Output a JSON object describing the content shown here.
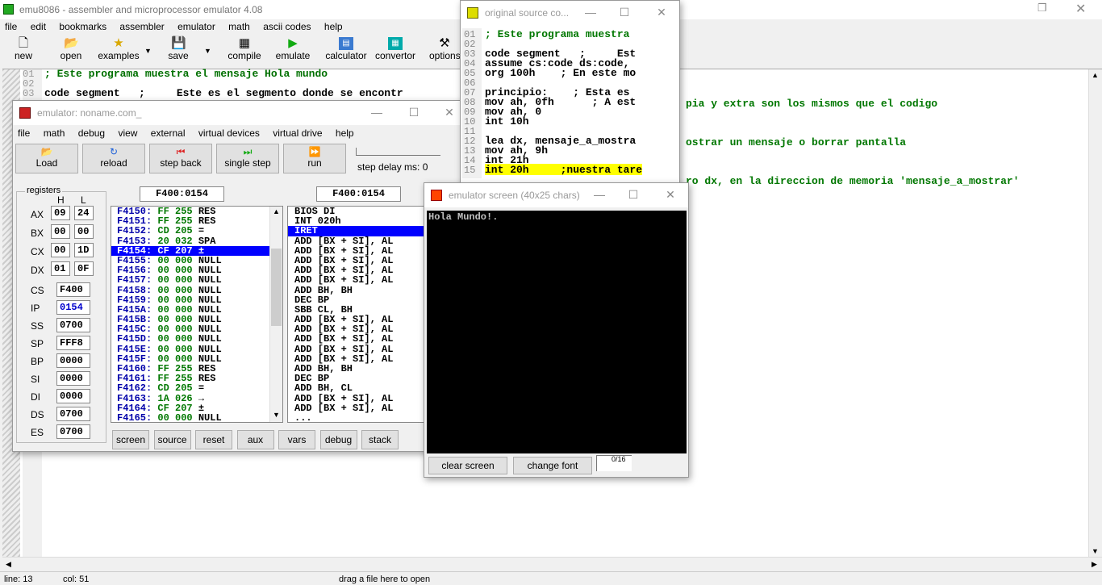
{
  "main_window": {
    "title": "emu8086 - assembler and microprocessor emulator 4.08",
    "menu": [
      "file",
      "edit",
      "bookmarks",
      "assembler",
      "emulator",
      "math",
      "ascii codes",
      "help"
    ],
    "toolbar": [
      {
        "label": "new",
        "icon": "new-file-icon"
      },
      {
        "label": "open",
        "icon": "open-folder-icon"
      },
      {
        "label": "examples",
        "icon": "star-icon"
      },
      {
        "label": "save",
        "icon": "floppy-disk-icon"
      },
      {
        "label": "compile",
        "icon": "compile-icon"
      },
      {
        "label": "emulate",
        "icon": "play-icon"
      },
      {
        "label": "calculator",
        "icon": "calculator-icon"
      },
      {
        "label": "convertor",
        "icon": "convertor-icon"
      },
      {
        "label": "options",
        "icon": "tools-icon"
      }
    ],
    "editor_lines": [
      {
        "num": "01",
        "text": "; Este programa muestra el mensaje Hola mundo"
      },
      {
        "num": "02",
        "text": ""
      },
      {
        "num": "03",
        "text": "code segment   ;     Este es el segmento donde se encontr"
      }
    ],
    "editor_right_fragments": [
      "pia y extra son los mismos que el codigo",
      "ostrar un mensaje o borrar pantalla",
      "ro dx, en la direccion de memoria 'mensaje_a_mostrar'"
    ],
    "status": {
      "line": "line: 13",
      "col": "col: 51",
      "drag_hint": "drag a file here to open"
    }
  },
  "emulator_window": {
    "title": "emulator: noname.com_",
    "menu": [
      "file",
      "math",
      "debug",
      "view",
      "external",
      "virtual devices",
      "virtual drive",
      "help"
    ],
    "buttons": {
      "load": "Load",
      "reload": "reload",
      "step_back": "step back",
      "single_step": "single step",
      "run": "run"
    },
    "step_delay": "step delay ms: 0",
    "registers_label": "registers",
    "h_label": "H",
    "l_label": "L",
    "registers_hl": [
      {
        "name": "AX",
        "h": "09",
        "l": "24"
      },
      {
        "name": "BX",
        "h": "00",
        "l": "00"
      },
      {
        "name": "CX",
        "h": "00",
        "l": "1D"
      },
      {
        "name": "DX",
        "h": "01",
        "l": "0F"
      }
    ],
    "registers_full": [
      {
        "name": "CS",
        "value": "F400"
      },
      {
        "name": "IP",
        "value": "0154"
      },
      {
        "name": "SS",
        "value": "0700"
      },
      {
        "name": "SP",
        "value": "FFF8"
      },
      {
        "name": "BP",
        "value": "0000"
      },
      {
        "name": "SI",
        "value": "0000"
      },
      {
        "name": "DI",
        "value": "0000"
      },
      {
        "name": "DS",
        "value": "0700"
      },
      {
        "name": "ES",
        "value": "0700"
      }
    ],
    "addr_left": "F400:0154",
    "addr_right": "F400:0154",
    "memory": [
      [
        "F4150:",
        "FF",
        "255",
        "RES"
      ],
      [
        "F4151:",
        "FF",
        "255",
        "RES"
      ],
      [
        "F4152:",
        "CD",
        "205",
        "="
      ],
      [
        "F4153:",
        "20",
        "032",
        "SPA"
      ],
      [
        "F4154:",
        "CF",
        "207",
        "±"
      ],
      [
        "F4155:",
        "00",
        "000",
        "NULL"
      ],
      [
        "F4156:",
        "00",
        "000",
        "NULL"
      ],
      [
        "F4157:",
        "00",
        "000",
        "NULL"
      ],
      [
        "F4158:",
        "00",
        "000",
        "NULL"
      ],
      [
        "F4159:",
        "00",
        "000",
        "NULL"
      ],
      [
        "F415A:",
        "00",
        "000",
        "NULL"
      ],
      [
        "F415B:",
        "00",
        "000",
        "NULL"
      ],
      [
        "F415C:",
        "00",
        "000",
        "NULL"
      ],
      [
        "F415D:",
        "00",
        "000",
        "NULL"
      ],
      [
        "F415E:",
        "00",
        "000",
        "NULL"
      ],
      [
        "F415F:",
        "00",
        "000",
        "NULL"
      ],
      [
        "F4160:",
        "FF",
        "255",
        "RES"
      ],
      [
        "F4161:",
        "FF",
        "255",
        "RES"
      ],
      [
        "F4162:",
        "CD",
        "205",
        "="
      ],
      [
        "F4163:",
        "1A",
        "026",
        "→"
      ],
      [
        "F4164:",
        "CF",
        "207",
        "±"
      ],
      [
        "F4165:",
        "00",
        "000",
        "NULL"
      ]
    ],
    "memory_selected_index": 4,
    "disasm": [
      "BIOS DI",
      "INT 020h",
      "IRET",
      "ADD [BX + SI], AL",
      "ADD [BX + SI], AL",
      "ADD [BX + SI], AL",
      "ADD [BX + SI], AL",
      "ADD [BX + SI], AL",
      "ADD BH, BH",
      "DEC BP",
      "SBB CL, BH",
      "ADD [BX + SI], AL",
      "ADD [BX + SI], AL",
      "ADD [BX + SI], AL",
      "ADD [BX + SI], AL",
      "ADD [BX + SI], AL",
      "ADD BH, BH",
      "DEC BP",
      "ADD BH, CL",
      "ADD [BX + SI], AL",
      "ADD [BX + SI], AL",
      "..."
    ],
    "disasm_selected_index": 2,
    "bottom_buttons": [
      "screen",
      "source",
      "reset",
      "aux",
      "vars",
      "debug",
      "stack"
    ]
  },
  "source_window": {
    "title": "original source co...",
    "lines": [
      {
        "num": "01",
        "text": "; Este programa muestra"
      },
      {
        "num": "02",
        "text": ""
      },
      {
        "num": "03",
        "text": "code segment   ;     Est"
      },
      {
        "num": "04",
        "text": "assume cs:code ds:code,"
      },
      {
        "num": "05",
        "text": "org 100h    ; En este mo"
      },
      {
        "num": "06",
        "text": ""
      },
      {
        "num": "07",
        "text": "principio:    ; Esta es"
      },
      {
        "num": "08",
        "text": "mov ah, 0fh      ; A est"
      },
      {
        "num": "09",
        "text": "mov ah, 0"
      },
      {
        "num": "10",
        "text": "int 10h"
      },
      {
        "num": "11",
        "text": ""
      },
      {
        "num": "12",
        "text": "lea dx, mensaje_a_mostra"
      },
      {
        "num": "13",
        "text": "mov ah, 9h"
      },
      {
        "num": "14",
        "text": "int 21h"
      },
      {
        "num": "15",
        "text": "int 20h     ;nuestra tare"
      }
    ],
    "highlight_index": 14
  },
  "screen_window": {
    "title": "emulator screen (40x25 chars)",
    "output": "Hola Mundo!.",
    "clear_label": "clear screen",
    "font_label": "change font",
    "counter": "0/16"
  }
}
